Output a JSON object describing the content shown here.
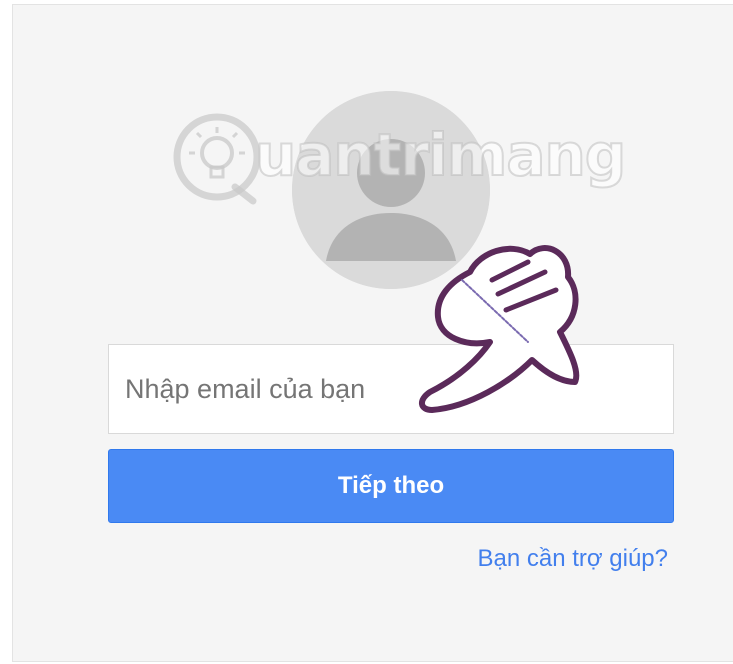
{
  "login": {
    "email_placeholder": "Nhập email của bạn",
    "next_label": "Tiếp theo",
    "help_link": "Bạn cần trợ giúp?"
  },
  "watermark": {
    "text": "uantrimang"
  },
  "icons": {
    "avatar": "default-user-avatar-icon",
    "watermark_logo": "lightbulb-logo-icon",
    "pointer": "pointing-hand-icon"
  },
  "colors": {
    "card_background": "#f5f5f5",
    "button_blue": "#4a8af4",
    "link_blue": "#427fed",
    "avatar_gray": "#dadada",
    "hand_outline": "#5b2a5a"
  }
}
